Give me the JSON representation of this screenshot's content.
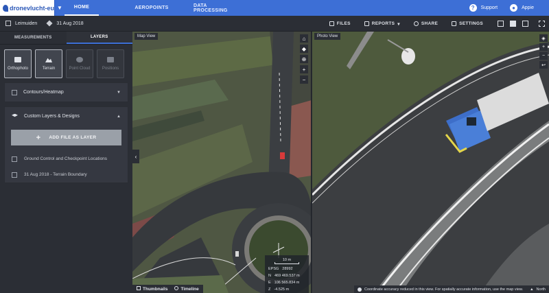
{
  "app": {
    "logo_text": "dronevlucht-eu",
    "nav": {
      "home": "HOME",
      "aeropoints": "AEROPOINTS",
      "processing": "DATA PROCESSING"
    },
    "support": "Support",
    "user": "Appie"
  },
  "toolbar": {
    "breadcrumb_site": "Leimuiden",
    "breadcrumb_date": "31 Aug 2018",
    "files": "FILES",
    "reports": "REPORTS",
    "share": "SHARE",
    "settings": "SETTINGS"
  },
  "sidebar": {
    "tabs": {
      "measurements": "MEASUREMENTS",
      "layers": "LAYERS"
    },
    "layer_buttons": {
      "orthophoto": "Orthophoto",
      "terrain": "Terrain",
      "pointcloud": "Point Cloud",
      "positions": "Positions"
    },
    "contours": "Contours/Heatmap",
    "custom_layers": "Custom Layers & Designs",
    "add_file": "ADD FILE AS LAYER",
    "gcp": "Ground Control and Checkpoint Locations",
    "boundary": "31 Aug 2018 - Terrain Boundary"
  },
  "mapview": {
    "label": "Map View",
    "scale": "10 m",
    "epsg_label": "EPSG",
    "epsg_value": "28992",
    "n_label": "N",
    "n_value": "469 469.537 m",
    "e_label": "E",
    "e_value": "106 565.834 m",
    "z_label": "Z",
    "z_value": "-4.525 m",
    "thumbnails": "Thumbnails",
    "timeline": "Timeline"
  },
  "photoview": {
    "label": "Photo View",
    "notice": "Coordinate accuracy reduced in this view. For spatially accurate information, use the map view.",
    "north": "North"
  },
  "colors": {
    "accent": "#3d6fd6",
    "sidebar_bg": "#2b2e35",
    "panel_bg": "#353841"
  }
}
